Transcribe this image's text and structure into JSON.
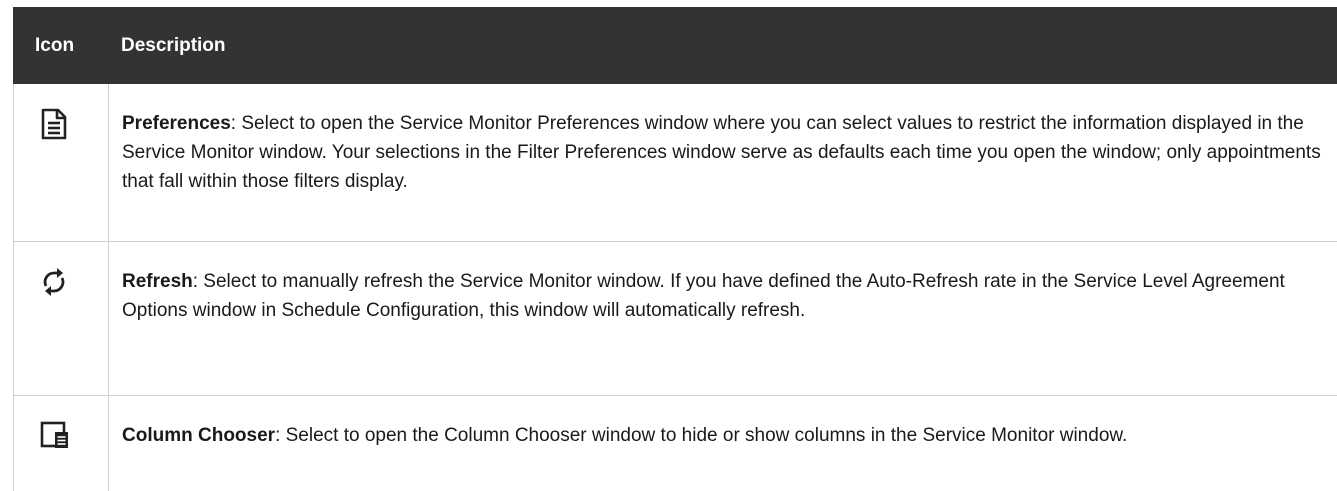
{
  "table": {
    "header": {
      "icon_col": "Icon",
      "desc_col": "Description"
    },
    "rows": [
      {
        "icon": "document-icon",
        "title": "Preferences",
        "text": ": Select to open the Service Monitor Preferences window where you can select values to restrict the information displayed in the Service Monitor window. Your selections in the Filter Preferences window serve as defaults each time you open the window; only appointments that fall within those filters display."
      },
      {
        "icon": "refresh-icon",
        "title": "Refresh",
        "text": ": Select to manually refresh the Service Monitor window. If you have defined the Auto-Refresh rate in the Service Level Agreement Options window in Schedule Configuration, this window will automatically refresh."
      },
      {
        "icon": "column-chooser-icon",
        "title": "Column Chooser",
        "text": ": Select to open the Column Chooser window to hide or show columns in the Service Monitor window."
      }
    ]
  }
}
